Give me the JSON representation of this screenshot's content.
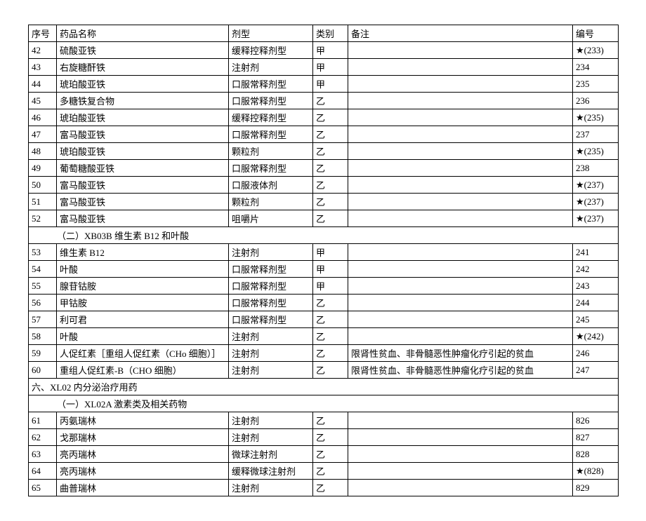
{
  "headers": {
    "num": "序号",
    "name": "药品名称",
    "form": "剂型",
    "cat": "类别",
    "remark": "备注",
    "code": "编号"
  },
  "rows": [
    {
      "type": "data",
      "num": "42",
      "name": "硫酸亚铁",
      "form": "缓释控释剂型",
      "cat": "甲",
      "remark": "",
      "code": "★(233)"
    },
    {
      "type": "data",
      "num": "43",
      "name": "右旋糖酐铁",
      "form": "注射剂",
      "cat": "甲",
      "remark": "",
      "code": "234"
    },
    {
      "type": "data",
      "num": "44",
      "name": "琥珀酸亚铁",
      "form": "口服常释剂型",
      "cat": "甲",
      "remark": "",
      "code": "235"
    },
    {
      "type": "data",
      "num": "45",
      "name": "多糖铁复合物",
      "form": "口服常释剂型",
      "cat": "乙",
      "remark": "",
      "code": "236"
    },
    {
      "type": "data",
      "num": "46",
      "name": "琥珀酸亚铁",
      "form": "缓释控释剂型",
      "cat": "乙",
      "remark": "",
      "code": "★(235)"
    },
    {
      "type": "data",
      "num": "47",
      "name": "富马酸亚铁",
      "form": "口服常释剂型",
      "cat": "乙",
      "remark": "",
      "code": "237"
    },
    {
      "type": "data",
      "num": "48",
      "name": "琥珀酸亚铁",
      "form": "颗粒剂",
      "cat": "乙",
      "remark": "",
      "code": "★(235)"
    },
    {
      "type": "data",
      "num": "49",
      "name": "葡萄糖酸亚铁",
      "form": "口服常释剂型",
      "cat": "乙",
      "remark": "",
      "code": "238"
    },
    {
      "type": "data",
      "num": "50",
      "name": "富马酸亚铁",
      "form": "口服液体剂",
      "cat": "乙",
      "remark": "",
      "code": "★(237)"
    },
    {
      "type": "data",
      "num": "51",
      "name": "富马酸亚铁",
      "form": "颗粒剂",
      "cat": "乙",
      "remark": "",
      "code": "★(237)"
    },
    {
      "type": "data",
      "num": "52",
      "name": "富马酸亚铁",
      "form": "咀嚼片",
      "cat": "乙",
      "remark": "",
      "code": "★(237)"
    },
    {
      "type": "group",
      "label": "（二）XB03B 维生素 B12 和叶酸"
    },
    {
      "type": "data",
      "num": "53",
      "name": "维生素 B12",
      "form": "注射剂",
      "cat": "甲",
      "remark": "",
      "code": "241"
    },
    {
      "type": "data",
      "num": "54",
      "name": "叶酸",
      "form": "口服常释剂型",
      "cat": "甲",
      "remark": "",
      "code": "242"
    },
    {
      "type": "data",
      "num": "55",
      "name": "腺苷钴胺",
      "form": "口服常释剂型",
      "cat": "甲",
      "remark": "",
      "code": "243"
    },
    {
      "type": "data",
      "num": "56",
      "name": "甲钴胺",
      "form": "口服常释剂型",
      "cat": "乙",
      "remark": "",
      "code": "244"
    },
    {
      "type": "data",
      "num": "57",
      "name": "利可君",
      "form": "口服常释剂型",
      "cat": "乙",
      "remark": "",
      "code": "245"
    },
    {
      "type": "data",
      "num": "58",
      "name": "叶酸",
      "form": "注射剂",
      "cat": "乙",
      "remark": "",
      "code": "★(242)"
    },
    {
      "type": "data",
      "num": "59",
      "name": "人促红素［重组人促红素（CHo 细胞）］",
      "form": "注射剂",
      "cat": "乙",
      "remark": "限肾性贫血、非骨髓恶性肿瘤化疗引起的贫血",
      "code": "246"
    },
    {
      "type": "data",
      "num": "60",
      "name": "重组人促红素-B（CHO 细胞）",
      "form": "注射剂",
      "cat": "乙",
      "remark": "限肾性贫血、非骨髓恶性肿瘤化疗引起的贫血",
      "code": "247"
    },
    {
      "type": "group-top",
      "label": "六、XL02 内分泌治疗用药"
    },
    {
      "type": "group",
      "label": "（一）XL02A 激素类及相关药物"
    },
    {
      "type": "data",
      "num": "61",
      "name": "丙氨瑞林",
      "form": "注射剂",
      "cat": "乙",
      "remark": "",
      "code": "826"
    },
    {
      "type": "data",
      "num": "62",
      "name": "戈那瑞林",
      "form": "注射剂",
      "cat": "乙",
      "remark": "",
      "code": "827"
    },
    {
      "type": "data",
      "num": "63",
      "name": "亮丙瑞林",
      "form": "微球注射剂",
      "cat": "乙",
      "remark": "",
      "code": "828"
    },
    {
      "type": "data",
      "num": "64",
      "name": "亮丙瑞林",
      "form": "缓释微球注射剂",
      "cat": "乙",
      "remark": "",
      "code": "★(828)"
    },
    {
      "type": "data",
      "num": "65",
      "name": "曲普瑞林",
      "form": "注射剂",
      "cat": "乙",
      "remark": "",
      "code": "829"
    }
  ]
}
